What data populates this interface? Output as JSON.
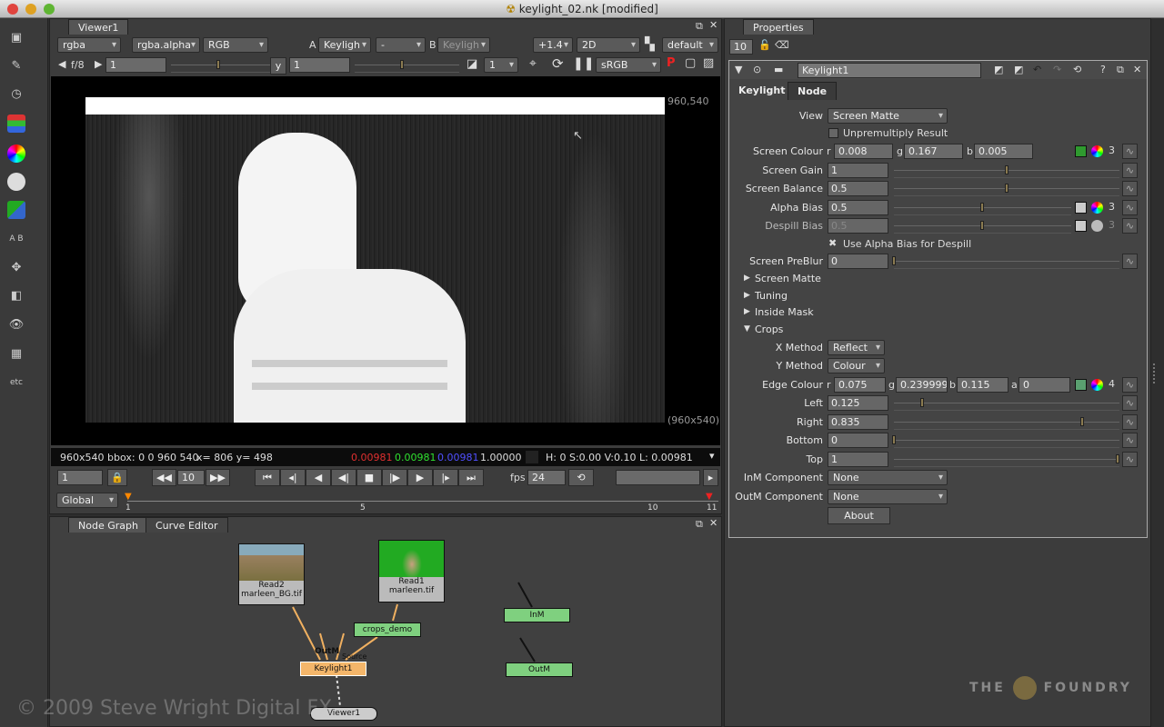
{
  "window": {
    "title": "keylight_02.nk [modified]",
    "icon": "nuke-icon"
  },
  "left_toolbar": [
    "select-icon",
    "paint-icon",
    "time-icon",
    "channel-icon",
    "color-icon",
    "filter-icon",
    "keyer-icon",
    "merge-icon",
    "transform-icon",
    "3d-icon",
    "views-icon",
    "metadata-icon",
    "other"
  ],
  "other_label": "etc",
  "viewer": {
    "tab": "Viewer1",
    "channels": "rgba",
    "alpha_channel": "rgba.alpha",
    "display": "RGB",
    "a_label": "A",
    "a_input": "Keyligh",
    "a_op": "-",
    "b_label": "B",
    "b_input": "Keyligh",
    "gain_value": "+1.4",
    "mode": "2D",
    "lut_default": "default",
    "fstop": "f/8",
    "gain_field": "1",
    "gamma_label": "y",
    "gamma_field": "1",
    "proxy": "1",
    "colorspace": "sRGB",
    "format_top": "960,540",
    "format_bottom": "(960x540)",
    "info": {
      "size": "960x540 bbox: 0 0 960 540",
      "coords": "x= 806 y= 498",
      "r": "0.00981",
      "g": "0.00981",
      "b": "0.00981",
      "a": "1.00000",
      "hsvl": "H:  0 S:0.00 V:0.10  L: 0.00981"
    },
    "frame": "1",
    "step": "10",
    "fps_label": "fps",
    "fps": "24",
    "range_mode": "Global",
    "timeline_ticks": [
      "1",
      "5",
      "10",
      "11"
    ],
    "colors": {
      "r": "#e03030",
      "g": "#30e030",
      "b": "#4040ff"
    }
  },
  "node_graph": {
    "tabs": [
      "Node Graph",
      "Curve Editor"
    ],
    "nodes": {
      "read2": [
        "Read2",
        "marleen_BG.tif"
      ],
      "read1": [
        "Read1",
        "marleen.tif"
      ],
      "crops": "crops_demo",
      "keylight": "Keylight1",
      "viewer": "Viewer1",
      "inm": "InM",
      "outm": "OutM"
    },
    "input_labels": [
      "OutM",
      "Source"
    ],
    "watermark": "© 2009 Steve Wright Digital FX",
    "brand": [
      "THE",
      "FOUNDRY"
    ]
  },
  "properties": {
    "tab": "Properties",
    "max_panels": "10",
    "node_name": "Keylight1",
    "tabs": [
      "Keylight",
      "Node"
    ],
    "view_label": "View",
    "view": "Screen Matte",
    "unpremult": "Unpremultiply Result",
    "screen_colour": {
      "label": "Screen Colour",
      "r": "0.008",
      "g": "0.167",
      "b": "0.005",
      "count": "3",
      "swatch": "#2f9a2f"
    },
    "screen_gain": {
      "label": "Screen Gain",
      "value": "1",
      "fraction": 0.5
    },
    "screen_balance": {
      "label": "Screen Balance",
      "value": "0.5",
      "fraction": 0.5
    },
    "alpha_bias": {
      "label": "Alpha Bias",
      "value": "0.5",
      "fraction": 0.5,
      "count": "3"
    },
    "despill_bias": {
      "label": "Despill Bias",
      "value": "0.5",
      "fraction": 0.5,
      "count": "3"
    },
    "use_alpha_bias": "Use Alpha Bias for Despill",
    "preblur": {
      "label": "Screen PreBlur",
      "value": "0",
      "fraction": 0
    },
    "groups": [
      "Screen Matte",
      "Tuning",
      "Inside Mask",
      "Crops"
    ],
    "x_method": {
      "label": "X Method",
      "value": "Reflect"
    },
    "y_method": {
      "label": "Y Method",
      "value": "Colour"
    },
    "edge_colour": {
      "label": "Edge Colour",
      "r": "0.075",
      "g": "0.2399999",
      "b": "0.115",
      "a": "0",
      "count": "4",
      "swatch": "#5aa070"
    },
    "left": {
      "label": "Left",
      "value": "0.125",
      "fraction": 0.125
    },
    "right": {
      "label": "Right",
      "value": "0.835",
      "fraction": 0.835
    },
    "bottom": {
      "label": "Bottom",
      "value": "0",
      "fraction": 0
    },
    "top": {
      "label": "Top",
      "value": "1",
      "fraction": 1
    },
    "inm": {
      "label": "InM Component",
      "value": "None"
    },
    "outm": {
      "label": "OutM Component",
      "value": "None"
    },
    "about": "About"
  }
}
